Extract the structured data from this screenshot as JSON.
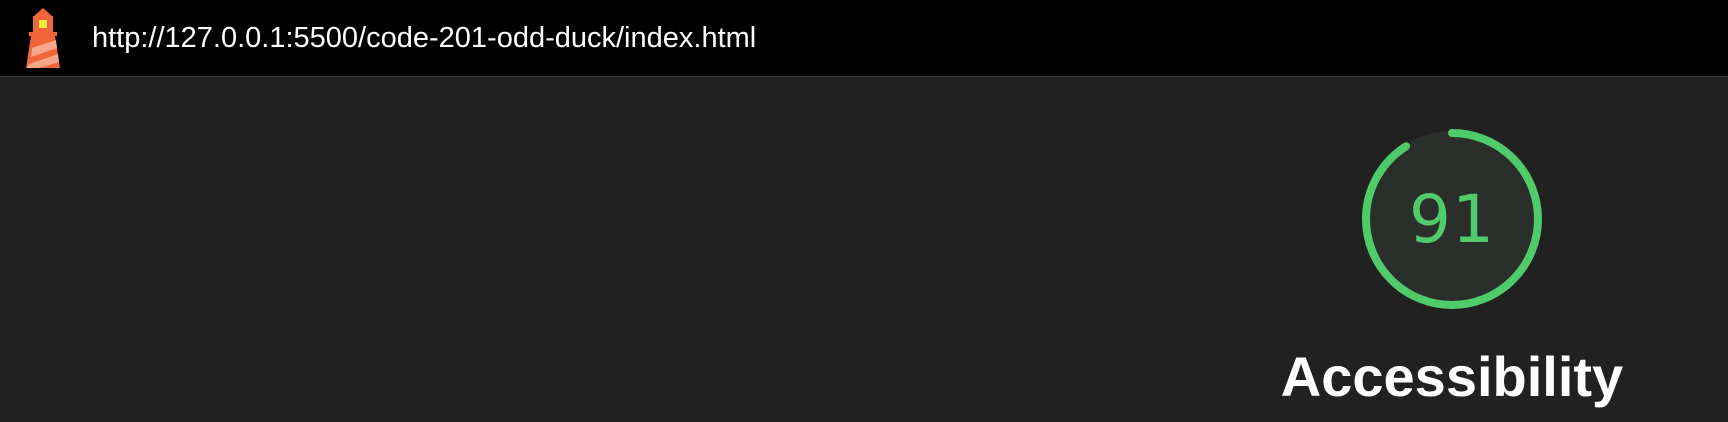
{
  "topbar": {
    "logo_icon": "lighthouse-icon",
    "url": "http://127.0.0.1:5500/code-201-odd-duck/index.html"
  },
  "gauge": {
    "score": "91",
    "score_value": 91,
    "title": "Accessibility",
    "color": "#4fcb6a"
  },
  "colors": {
    "background": "#212121",
    "topbar": "#000000",
    "gauge_fill": "#2a2f2b"
  }
}
